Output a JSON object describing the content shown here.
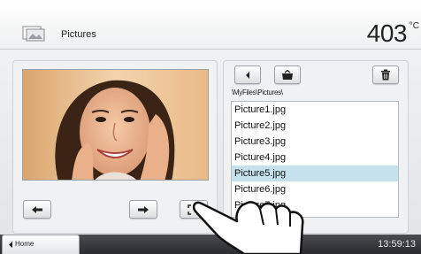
{
  "header": {
    "title": "Pictures",
    "temperature": "403",
    "unit": "°C",
    "icon": "pictures-icon"
  },
  "browser": {
    "path": "\\MyFiles\\Pictures\\",
    "files": [
      "Picture1.jpg",
      "Picture2.jpg",
      "Picture3.jpg",
      "Picture4.jpg",
      "Picture5.jpg",
      "Picture6.jpg",
      "Picture7.jpg"
    ],
    "selected_index": 4
  },
  "footer": {
    "home_label": "Home",
    "clock": "13:59:13"
  },
  "icons": {
    "prev": "arrow-left-icon",
    "next": "arrow-right-icon",
    "fullscreen": "fullscreen-icon",
    "back": "back-icon",
    "folder": "folder-icon",
    "delete": "trash-icon",
    "hand": "pointing-hand-icon"
  },
  "colors": {
    "selection": "#c4e1ec",
    "footer": "#2a2b2e"
  }
}
